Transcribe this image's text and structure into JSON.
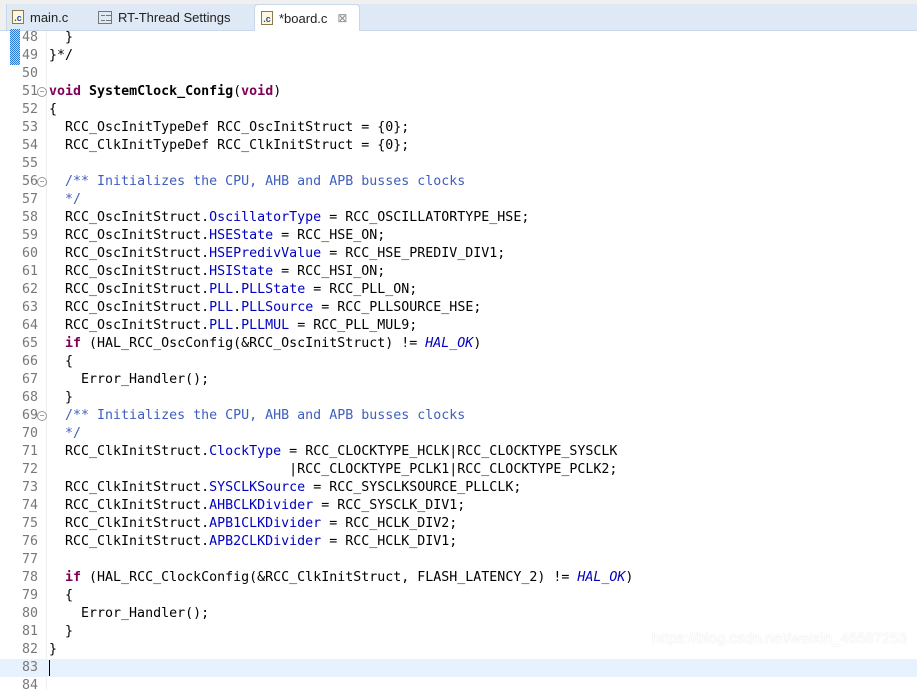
{
  "tabs": [
    {
      "label": "main.c",
      "icon": "c-file-icon",
      "active": false
    },
    {
      "label": "RT-Thread Settings",
      "icon": "settings-icon",
      "active": false
    },
    {
      "label": "*board.c",
      "icon": "c-file-icon",
      "active": true,
      "close": "⊠"
    }
  ],
  "file_icon_letter": ".c",
  "code": {
    "current_line": 83,
    "changed_lines": [
      48,
      49
    ],
    "folded_lines": [
      51,
      56,
      69
    ],
    "lines": [
      {
        "n": "48",
        "tokens": [
          [
            "  }",
            "p"
          ]
        ]
      },
      {
        "n": "49",
        "tokens": [
          [
            "}*/",
            "p"
          ]
        ]
      },
      {
        "n": "50",
        "tokens": []
      },
      {
        "n": "51",
        "tokens": [
          [
            "void",
            "k"
          ],
          [
            " ",
            "p"
          ],
          [
            "SystemClock_Config",
            "b"
          ],
          [
            "(",
            "p"
          ],
          [
            "void",
            "k"
          ],
          [
            ")",
            "p"
          ]
        ]
      },
      {
        "n": "52",
        "tokens": [
          [
            "{",
            "p"
          ]
        ]
      },
      {
        "n": "53",
        "tokens": [
          [
            "  RCC_OscInitTypeDef RCC_OscInitStruct = {0};",
            "p"
          ]
        ]
      },
      {
        "n": "54",
        "tokens": [
          [
            "  RCC_ClkInitTypeDef RCC_ClkInitStruct = {0};",
            "p"
          ]
        ]
      },
      {
        "n": "55",
        "tokens": []
      },
      {
        "n": "56",
        "tokens": [
          [
            "  ",
            "p"
          ],
          [
            "/** Initializes the CPU, AHB and APB busses clocks",
            "c"
          ]
        ]
      },
      {
        "n": "57",
        "tokens": [
          [
            "  ",
            "p"
          ],
          [
            "*/",
            "c"
          ]
        ]
      },
      {
        "n": "58",
        "tokens": [
          [
            "  RCC_OscInitStruct.",
            "p"
          ],
          [
            "OscillatorType",
            "f"
          ],
          [
            " = RCC_OSCILLATORTYPE_HSE;",
            "p"
          ]
        ]
      },
      {
        "n": "59",
        "tokens": [
          [
            "  RCC_OscInitStruct.",
            "p"
          ],
          [
            "HSEState",
            "f"
          ],
          [
            " = RCC_HSE_ON;",
            "p"
          ]
        ]
      },
      {
        "n": "60",
        "tokens": [
          [
            "  RCC_OscInitStruct.",
            "p"
          ],
          [
            "HSEPredivValue",
            "f"
          ],
          [
            " = RCC_HSE_PREDIV_DIV1;",
            "p"
          ]
        ]
      },
      {
        "n": "61",
        "tokens": [
          [
            "  RCC_OscInitStruct.",
            "p"
          ],
          [
            "HSIState",
            "f"
          ],
          [
            " = RCC_HSI_ON;",
            "p"
          ]
        ]
      },
      {
        "n": "62",
        "tokens": [
          [
            "  RCC_OscInitStruct.",
            "p"
          ],
          [
            "PLL",
            "f"
          ],
          [
            ".",
            "p"
          ],
          [
            "PLLState",
            "f"
          ],
          [
            " = RCC_PLL_ON;",
            "p"
          ]
        ]
      },
      {
        "n": "63",
        "tokens": [
          [
            "  RCC_OscInitStruct.",
            "p"
          ],
          [
            "PLL",
            "f"
          ],
          [
            ".",
            "p"
          ],
          [
            "PLLSource",
            "f"
          ],
          [
            " = RCC_PLLSOURCE_HSE;",
            "p"
          ]
        ]
      },
      {
        "n": "64",
        "tokens": [
          [
            "  RCC_OscInitStruct.",
            "p"
          ],
          [
            "PLL",
            "f"
          ],
          [
            ".",
            "p"
          ],
          [
            "PLLMUL",
            "f"
          ],
          [
            " = RCC_PLL_MUL9;",
            "p"
          ]
        ]
      },
      {
        "n": "65",
        "tokens": [
          [
            "  ",
            "p"
          ],
          [
            "if",
            "k"
          ],
          [
            " (HAL_RCC_OscConfig(&RCC_OscInitStruct) != ",
            "p"
          ],
          [
            "HAL_OK",
            "m"
          ],
          [
            ")",
            "p"
          ]
        ]
      },
      {
        "n": "66",
        "tokens": [
          [
            "  {",
            "p"
          ]
        ]
      },
      {
        "n": "67",
        "tokens": [
          [
            "    Error_Handler();",
            "p"
          ]
        ]
      },
      {
        "n": "68",
        "tokens": [
          [
            "  }",
            "p"
          ]
        ]
      },
      {
        "n": "69",
        "tokens": [
          [
            "  ",
            "p"
          ],
          [
            "/** Initializes the CPU, AHB and APB busses clocks",
            "c"
          ]
        ]
      },
      {
        "n": "70",
        "tokens": [
          [
            "  ",
            "p"
          ],
          [
            "*/",
            "c"
          ]
        ]
      },
      {
        "n": "71",
        "tokens": [
          [
            "  RCC_ClkInitStruct.",
            "p"
          ],
          [
            "ClockType",
            "f"
          ],
          [
            " = RCC_CLOCKTYPE_HCLK|RCC_CLOCKTYPE_SYSCLK",
            "p"
          ]
        ]
      },
      {
        "n": "72",
        "tokens": [
          [
            "                              |RCC_CLOCKTYPE_PCLK1|RCC_CLOCKTYPE_PCLK2;",
            "p"
          ]
        ]
      },
      {
        "n": "73",
        "tokens": [
          [
            "  RCC_ClkInitStruct.",
            "p"
          ],
          [
            "SYSCLKSource",
            "f"
          ],
          [
            " = RCC_SYSCLKSOURCE_PLLCLK;",
            "p"
          ]
        ]
      },
      {
        "n": "74",
        "tokens": [
          [
            "  RCC_ClkInitStruct.",
            "p"
          ],
          [
            "AHBCLKDivider",
            "f"
          ],
          [
            " = RCC_SYSCLK_DIV1;",
            "p"
          ]
        ]
      },
      {
        "n": "75",
        "tokens": [
          [
            "  RCC_ClkInitStruct.",
            "p"
          ],
          [
            "APB1CLKDivider",
            "f"
          ],
          [
            " = RCC_HCLK_DIV2;",
            "p"
          ]
        ]
      },
      {
        "n": "76",
        "tokens": [
          [
            "  RCC_ClkInitStruct.",
            "p"
          ],
          [
            "APB2CLKDivider",
            "f"
          ],
          [
            " = RCC_HCLK_DIV1;",
            "p"
          ]
        ]
      },
      {
        "n": "77",
        "tokens": []
      },
      {
        "n": "78",
        "tokens": [
          [
            "  ",
            "p"
          ],
          [
            "if",
            "k"
          ],
          [
            " (HAL_RCC_ClockConfig(&RCC_ClkInitStruct, FLASH_LATENCY_2) != ",
            "p"
          ],
          [
            "HAL_OK",
            "m"
          ],
          [
            ")",
            "p"
          ]
        ]
      },
      {
        "n": "79",
        "tokens": [
          [
            "  {",
            "p"
          ]
        ]
      },
      {
        "n": "80",
        "tokens": [
          [
            "    Error_Handler();",
            "p"
          ]
        ]
      },
      {
        "n": "81",
        "tokens": [
          [
            "  }",
            "p"
          ]
        ]
      },
      {
        "n": "82",
        "tokens": [
          [
            "}",
            "p"
          ]
        ]
      },
      {
        "n": "83",
        "tokens": []
      },
      {
        "n": "84",
        "tokens": []
      }
    ]
  },
  "watermark": "https://blog.csdn.net/weixin_46587253",
  "colors": {
    "keyword": "#7f0055",
    "field": "#0000c0",
    "comment": "#3f5fbf",
    "current_line": "#e8f2fe"
  }
}
